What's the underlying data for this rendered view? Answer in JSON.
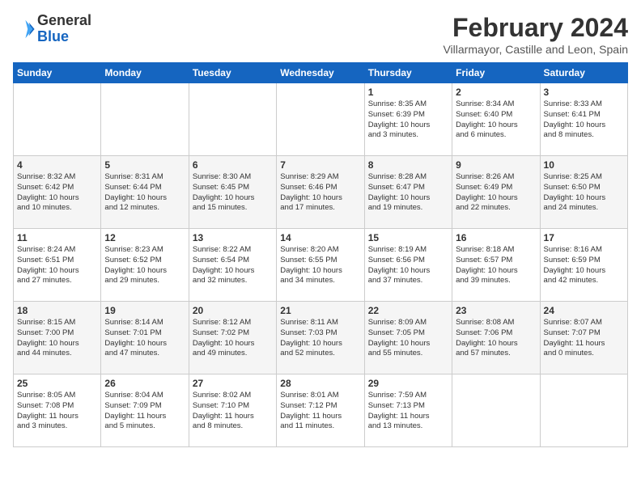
{
  "logo": {
    "general": "General",
    "blue": "Blue"
  },
  "title": "February 2024",
  "subtitle": "Villarmayor, Castille and Leon, Spain",
  "days_of_week": [
    "Sunday",
    "Monday",
    "Tuesday",
    "Wednesday",
    "Thursday",
    "Friday",
    "Saturday"
  ],
  "weeks": [
    [
      {
        "day": "",
        "content": ""
      },
      {
        "day": "",
        "content": ""
      },
      {
        "day": "",
        "content": ""
      },
      {
        "day": "",
        "content": ""
      },
      {
        "day": "1",
        "content": "Sunrise: 8:35 AM\nSunset: 6:39 PM\nDaylight: 10 hours\nand 3 minutes."
      },
      {
        "day": "2",
        "content": "Sunrise: 8:34 AM\nSunset: 6:40 PM\nDaylight: 10 hours\nand 6 minutes."
      },
      {
        "day": "3",
        "content": "Sunrise: 8:33 AM\nSunset: 6:41 PM\nDaylight: 10 hours\nand 8 minutes."
      }
    ],
    [
      {
        "day": "4",
        "content": "Sunrise: 8:32 AM\nSunset: 6:42 PM\nDaylight: 10 hours\nand 10 minutes."
      },
      {
        "day": "5",
        "content": "Sunrise: 8:31 AM\nSunset: 6:44 PM\nDaylight: 10 hours\nand 12 minutes."
      },
      {
        "day": "6",
        "content": "Sunrise: 8:30 AM\nSunset: 6:45 PM\nDaylight: 10 hours\nand 15 minutes."
      },
      {
        "day": "7",
        "content": "Sunrise: 8:29 AM\nSunset: 6:46 PM\nDaylight: 10 hours\nand 17 minutes."
      },
      {
        "day": "8",
        "content": "Sunrise: 8:28 AM\nSunset: 6:47 PM\nDaylight: 10 hours\nand 19 minutes."
      },
      {
        "day": "9",
        "content": "Sunrise: 8:26 AM\nSunset: 6:49 PM\nDaylight: 10 hours\nand 22 minutes."
      },
      {
        "day": "10",
        "content": "Sunrise: 8:25 AM\nSunset: 6:50 PM\nDaylight: 10 hours\nand 24 minutes."
      }
    ],
    [
      {
        "day": "11",
        "content": "Sunrise: 8:24 AM\nSunset: 6:51 PM\nDaylight: 10 hours\nand 27 minutes."
      },
      {
        "day": "12",
        "content": "Sunrise: 8:23 AM\nSunset: 6:52 PM\nDaylight: 10 hours\nand 29 minutes."
      },
      {
        "day": "13",
        "content": "Sunrise: 8:22 AM\nSunset: 6:54 PM\nDaylight: 10 hours\nand 32 minutes."
      },
      {
        "day": "14",
        "content": "Sunrise: 8:20 AM\nSunset: 6:55 PM\nDaylight: 10 hours\nand 34 minutes."
      },
      {
        "day": "15",
        "content": "Sunrise: 8:19 AM\nSunset: 6:56 PM\nDaylight: 10 hours\nand 37 minutes."
      },
      {
        "day": "16",
        "content": "Sunrise: 8:18 AM\nSunset: 6:57 PM\nDaylight: 10 hours\nand 39 minutes."
      },
      {
        "day": "17",
        "content": "Sunrise: 8:16 AM\nSunset: 6:59 PM\nDaylight: 10 hours\nand 42 minutes."
      }
    ],
    [
      {
        "day": "18",
        "content": "Sunrise: 8:15 AM\nSunset: 7:00 PM\nDaylight: 10 hours\nand 44 minutes."
      },
      {
        "day": "19",
        "content": "Sunrise: 8:14 AM\nSunset: 7:01 PM\nDaylight: 10 hours\nand 47 minutes."
      },
      {
        "day": "20",
        "content": "Sunrise: 8:12 AM\nSunset: 7:02 PM\nDaylight: 10 hours\nand 49 minutes."
      },
      {
        "day": "21",
        "content": "Sunrise: 8:11 AM\nSunset: 7:03 PM\nDaylight: 10 hours\nand 52 minutes."
      },
      {
        "day": "22",
        "content": "Sunrise: 8:09 AM\nSunset: 7:05 PM\nDaylight: 10 hours\nand 55 minutes."
      },
      {
        "day": "23",
        "content": "Sunrise: 8:08 AM\nSunset: 7:06 PM\nDaylight: 10 hours\nand 57 minutes."
      },
      {
        "day": "24",
        "content": "Sunrise: 8:07 AM\nSunset: 7:07 PM\nDaylight: 11 hours\nand 0 minutes."
      }
    ],
    [
      {
        "day": "25",
        "content": "Sunrise: 8:05 AM\nSunset: 7:08 PM\nDaylight: 11 hours\nand 3 minutes."
      },
      {
        "day": "26",
        "content": "Sunrise: 8:04 AM\nSunset: 7:09 PM\nDaylight: 11 hours\nand 5 minutes."
      },
      {
        "day": "27",
        "content": "Sunrise: 8:02 AM\nSunset: 7:10 PM\nDaylight: 11 hours\nand 8 minutes."
      },
      {
        "day": "28",
        "content": "Sunrise: 8:01 AM\nSunset: 7:12 PM\nDaylight: 11 hours\nand 11 minutes."
      },
      {
        "day": "29",
        "content": "Sunrise: 7:59 AM\nSunset: 7:13 PM\nDaylight: 11 hours\nand 13 minutes."
      },
      {
        "day": "",
        "content": ""
      },
      {
        "day": "",
        "content": ""
      }
    ]
  ]
}
